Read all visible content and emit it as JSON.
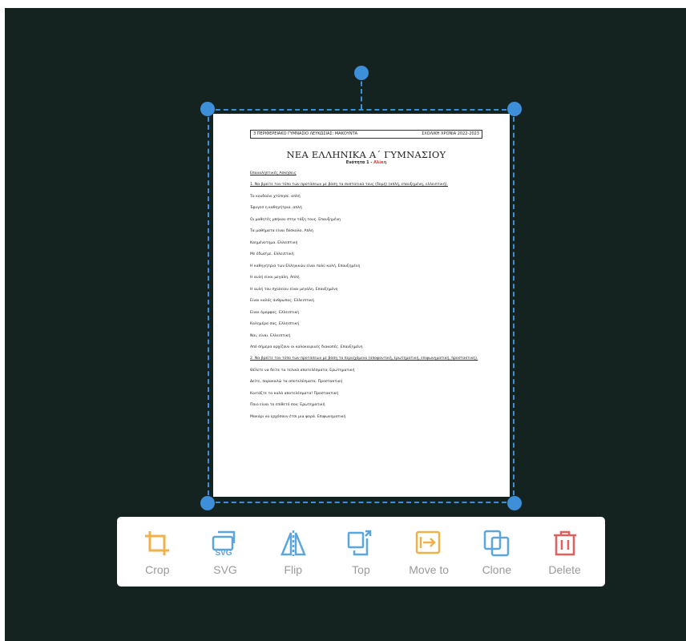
{
  "document": {
    "header_left": "3 ΠΕΡΙΦΕΡΕΙΑΚΟ ΓΥΜΝΑΣΙΟ ΛΕΥΚΩΣΙΑΣ: ΜΑΚΟΥΝΤΑ",
    "header_right": "ΣΧΟΛΙΚΗ ΧΡΟΝΙΑ 2022-2023",
    "title": "ΝΕΑ ΕΛΛΗΝΙΚΑ Α΄ ΓΥΜΝΑΣΙΟΥ",
    "subtitle_prefix": "Ενότητα 1 - ",
    "subtitle_highlight": "Αλίκη",
    "section": "Επαναληπτικές Ασκήσεις",
    "question1": "1. Να βρείτε τον τύπο των προτάσεων με βάση τα συστατικά τους (δομή) (απλή, επαυξημένη, ελλειπτική).",
    "lines1": [
      "Το κουδούνι χτύπησε. απλή",
      "Έφυγεσ η καθηγήτρια. απλή",
      "Οι μαθητές μπήκαν στην τάξη τους. Επαυξημένη",
      "Τα μαθήματα είναι δύσκολα. Απλή",
      "Καημένοτημα. Ελλειπτική",
      "Με έδωσ'με. Ελλειπτική",
      "Η καθηγήτρια των Ελληνικών είναι πολύ καλή. Επαυξημένη",
      "Η αυλή είναι μεγάλη. Απλή",
      "Η αυλή του σχολείου είναι μεγάλη. Επαυξημένη",
      "Είναι καλός άνθρωπος. Ελλειπτική",
      "Είναι όμορφος. Ελλειπτική",
      "Καλημέρα σας. Ελλειπτική",
      "Ναι, είναι. Ελλειπτική",
      "Από σήμερα αρχίζουν οι καλοκαιρινές διακοπές. Επαυξημένη"
    ],
    "question2": "2. Να βρείτε τον τύπο των προτάσεων με βάση το περιεχόμενο (αποφαντική, ερωτηματική, επιφωνηματική, προστακτική).",
    "lines2": [
      "Θέλετε να δείτε τα τελικά αποτελέσματα; Ερωτηματική",
      "Δείτε, παρακαλώ τα αποτελέσματα. Προστακτική",
      "Κοιτάξτε τα καλά αποτελέσματα! Προστακτική",
      "Ποιο είναι το επίθετό σου; Ερωτηματική",
      "Μακάρι να ερχόσουν έτσι μια φορά. Επιφωνηματική"
    ]
  },
  "toolbar": {
    "items": [
      {
        "label": "Crop",
        "icon": "crop-icon",
        "color": "#f0b14a"
      },
      {
        "label": "SVG",
        "icon": "svg-icon",
        "color": "#5aa6dd"
      },
      {
        "label": "Flip",
        "icon": "flip-icon",
        "color": "#5aa6dd"
      },
      {
        "label": "Top",
        "icon": "bring-to-top-icon",
        "color": "#5aa6dd"
      },
      {
        "label": "Move to",
        "icon": "move-to-icon",
        "color": "#f0b14a"
      },
      {
        "label": "Clone",
        "icon": "clone-icon",
        "color": "#5aa6dd"
      },
      {
        "label": "Delete",
        "icon": "trash-icon",
        "color": "#e0605d"
      }
    ]
  },
  "colors": {
    "canvas_bg": "#142320",
    "selection": "#3d8fd9",
    "label_gray": "#9a9a9a"
  }
}
